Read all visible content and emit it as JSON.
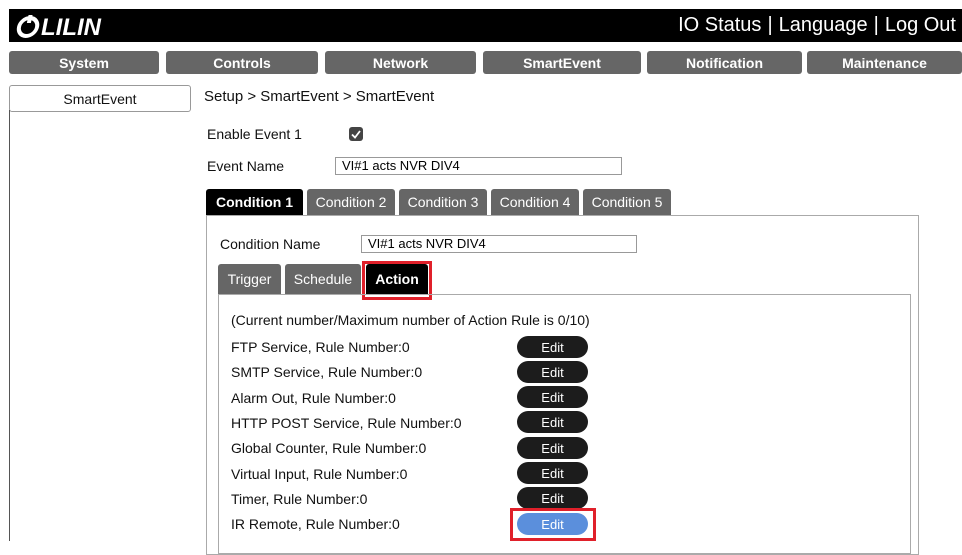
{
  "header": {
    "logo_text": "LILIN",
    "links": [
      "IO Status",
      "Language",
      "Log Out"
    ],
    "separator": "|"
  },
  "nav": {
    "tabs": [
      "System",
      "Controls",
      "Network",
      "SmartEvent",
      "Notification",
      "Maintenance"
    ]
  },
  "sidebar": {
    "items": [
      {
        "label": "SmartEvent"
      }
    ]
  },
  "breadcrumb": "Setup > SmartEvent > SmartEvent",
  "event": {
    "enable_label": "Enable Event 1",
    "enabled": true,
    "name_label": "Event Name",
    "name_value": "VI#1 acts NVR DIV4"
  },
  "condition_tabs": [
    "Condition 1",
    "Condition 2",
    "Condition 3",
    "Condition 4",
    "Condition 5"
  ],
  "condition": {
    "name_label": "Condition Name",
    "name_value": "VI#1 acts NVR DIV4"
  },
  "sub_tabs": [
    "Trigger",
    "Schedule",
    "Action"
  ],
  "action": {
    "info": "(Current number/Maximum number of Action Rule is 0/10)",
    "edit_label": "Edit",
    "rules": [
      "FTP Service, Rule Number:0",
      "SMTP Service, Rule Number:0",
      "Alarm Out, Rule Number:0",
      "HTTP POST Service, Rule Number:0",
      "Global Counter, Rule Number:0",
      "Virtual Input, Rule Number:0",
      "Timer, Rule Number:0",
      "IR Remote, Rule Number:0"
    ]
  },
  "colors": {
    "header_bg": "#000000",
    "tab_gray": "#666666",
    "highlight_red": "#e0202a",
    "edit_active": "#5b8fdc"
  }
}
